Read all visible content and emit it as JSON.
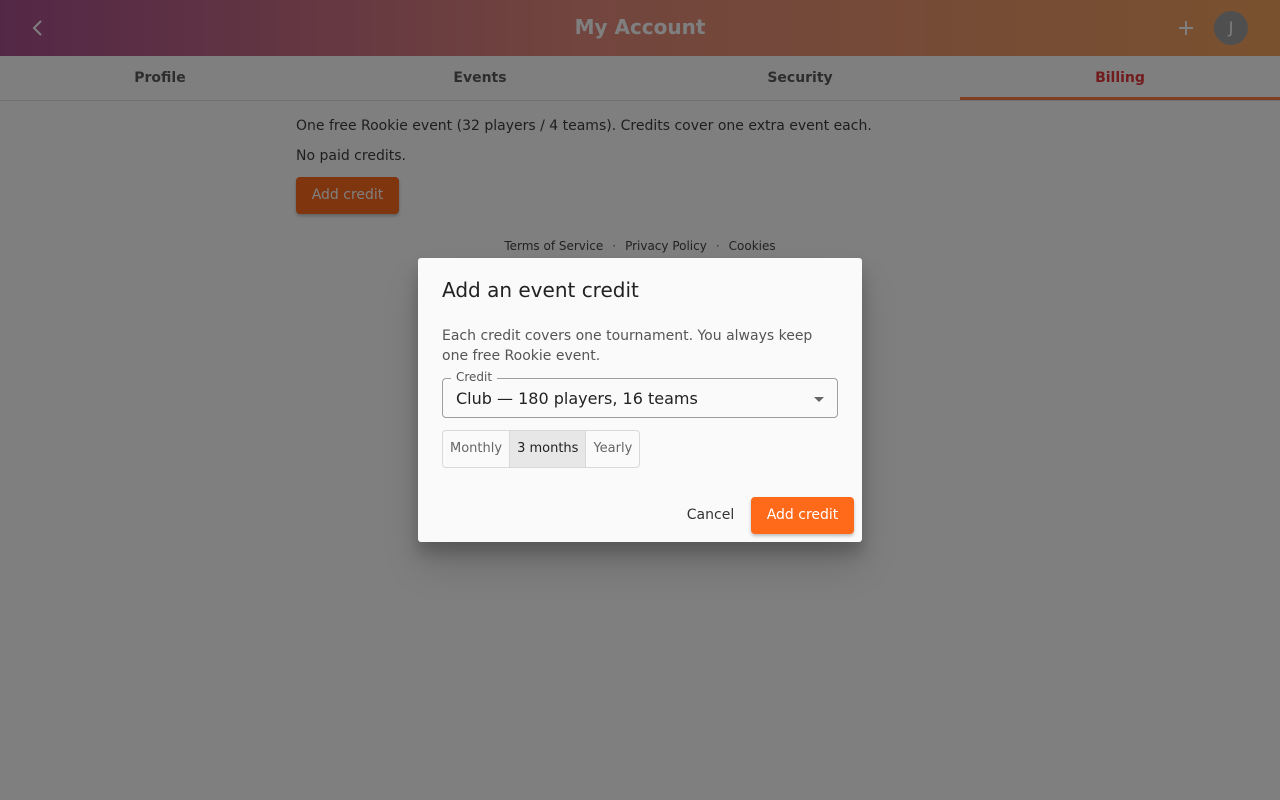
{
  "appbar": {
    "title": "My Account",
    "avatar_initial": "J",
    "back_icon": "chevron-left-icon",
    "add_icon": "plus-icon"
  },
  "tabs": [
    {
      "label": "Profile"
    },
    {
      "label": "Events"
    },
    {
      "label": "Security"
    },
    {
      "label": "Billing",
      "active": true
    }
  ],
  "billing": {
    "info": "One free Rookie event (32 players / 4 teams). Credits cover one extra event each.",
    "credits_status": "No paid credits.",
    "add_button": "Add credit"
  },
  "footer": {
    "terms": "Terms of Service",
    "privacy": "Privacy Policy",
    "cookies": "Cookies",
    "separator": "·"
  },
  "dialog": {
    "title": "Add an event credit",
    "description": "Each credit covers one tournament. You always keep one free Rookie event.",
    "select_label": "Credit",
    "select_value": "Club — 180 players, 16 teams",
    "periods": [
      {
        "label": "Monthly"
      },
      {
        "label": "3 months",
        "selected": true
      },
      {
        "label": "Yearly"
      }
    ],
    "cancel": "Cancel",
    "confirm": "Add credit"
  },
  "colors": {
    "accent": "#ff6a1a",
    "active_tab": "#e4363a",
    "tab_indicator": "#ff7f45"
  }
}
